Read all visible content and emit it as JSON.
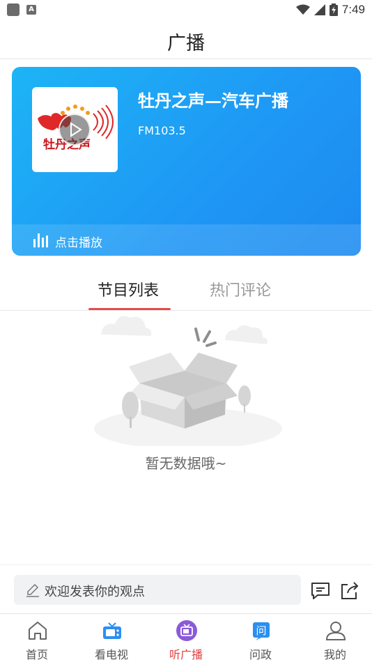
{
  "status_bar": {
    "time": "7:49",
    "left_icons": [
      "square-notification-icon",
      "a-notification-icon"
    ],
    "right_icons": [
      "wifi-icon",
      "signal-icon",
      "battery-icon"
    ]
  },
  "header": {
    "title": "广播"
  },
  "station": {
    "logo_text": "牡丹之声",
    "name": "牡丹之声—汽车广播",
    "frequency": "FM103.5",
    "play_label": "点击播放"
  },
  "tabs": [
    {
      "label": "节目列表",
      "active": true
    },
    {
      "label": "热门评论",
      "active": false
    }
  ],
  "empty_state": {
    "message": "暂无数据哦~"
  },
  "comment": {
    "placeholder": "欢迎发表你的观点"
  },
  "bottom_nav": [
    {
      "label": "首页",
      "icon": "home-icon",
      "active": false
    },
    {
      "label": "看电视",
      "icon": "tv-icon",
      "active": false
    },
    {
      "label": "听广播",
      "icon": "radio-icon",
      "active": true
    },
    {
      "label": "问政",
      "icon": "question-icon",
      "active": false
    },
    {
      "label": "我的",
      "icon": "user-icon",
      "active": false
    }
  ],
  "colors": {
    "accent_red": "#e23d3d",
    "card_blue": "#1e97f5",
    "nav_blue": "#2b8ff0",
    "nav_purple": "#8b5ad9"
  }
}
